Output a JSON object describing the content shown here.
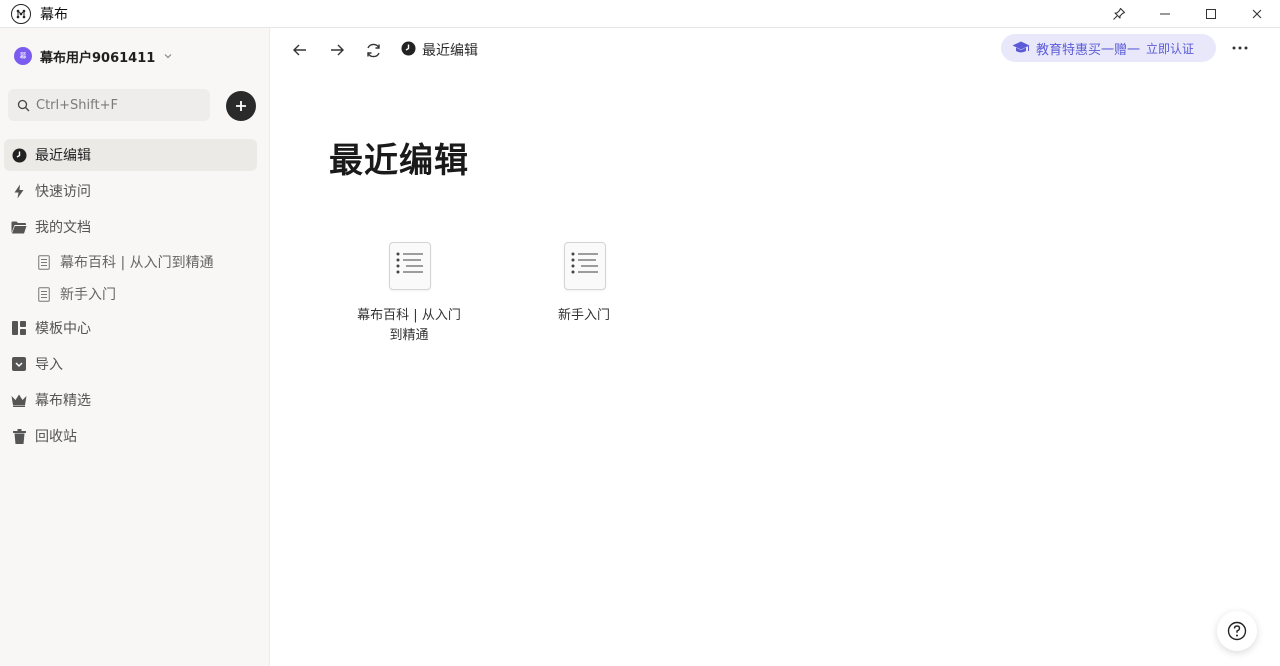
{
  "app": {
    "title": "幕布"
  },
  "sidebar": {
    "user": {
      "avatar_text": "幕",
      "name": "幕布用户9061411"
    },
    "search": {
      "placeholder": "Ctrl+Shift+F"
    },
    "items": [
      {
        "label": "最近编辑",
        "icon": "clock-icon",
        "active": true
      },
      {
        "label": "快速访问",
        "icon": "bolt-icon"
      },
      {
        "label": "我的文档",
        "icon": "folder-icon"
      },
      {
        "label": "幕布百科 | 从入门到精通",
        "icon": "document-icon",
        "child": true
      },
      {
        "label": "新手入门",
        "icon": "document-icon",
        "child": true
      },
      {
        "label": "模板中心",
        "icon": "template-grid-icon"
      },
      {
        "label": "导入",
        "icon": "import-icon"
      },
      {
        "label": "幕布精选",
        "icon": "crown-icon"
      },
      {
        "label": "回收站",
        "icon": "trash-icon"
      }
    ]
  },
  "toolbar": {
    "breadcrumb": "最近编辑",
    "promo_text": "教育特惠买一赠一",
    "promo_link": "立即认证"
  },
  "main": {
    "title": "最近编辑",
    "documents": [
      {
        "name_line1": "幕布百科 | 从入门",
        "name_line2": "到精通"
      },
      {
        "name_line1": "新手入门",
        "name_line2": ""
      }
    ]
  },
  "colors": {
    "accent": "#5b5bd6",
    "promo_bg": "#e9e8fb",
    "avatar": "#7b5cf0",
    "sidebar_bg": "#f8f7f5"
  }
}
